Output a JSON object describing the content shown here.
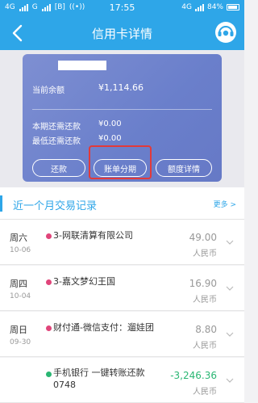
{
  "status_bar": {
    "left_items": [
      "4G",
      "G",
      "[B]",
      "((•))"
    ],
    "time": "17:55",
    "network": "4G",
    "battery": "84%"
  },
  "header": {
    "title": "信用卡详情"
  },
  "card": {
    "balance_label": "当前余额",
    "balance_value": "¥1,114.66",
    "due_label": "本期还需还款",
    "due_value": "¥0.00",
    "min_label": "最低还需还款",
    "min_value": "¥0.00",
    "btn_repay": "还款",
    "btn_installment": "账单分期",
    "btn_limit": "额度详情"
  },
  "section": {
    "title": "近一个月交易记录",
    "more": "更多 >"
  },
  "colors": {
    "brand": "#2ea6e8",
    "card": "#6e82cc",
    "highlight": "#e23a3a",
    "negative_amount": "#2ab673",
    "dot_red": "#e0457a",
    "dot_green": "#2ab673"
  },
  "transactions": [
    {
      "day": "周六",
      "date": "10-06",
      "desc": "3-网联清算有限公司",
      "desc2": "",
      "amount": "49.00",
      "currency": "人民币",
      "dot": "red"
    },
    {
      "day": "周四",
      "date": "10-04",
      "desc": "3-嘉文梦幻王国",
      "desc2": "",
      "amount": "16.90",
      "currency": "人民币",
      "dot": "red"
    },
    {
      "day": "周日",
      "date": "09-30",
      "desc": "财付通-微信支付：遛娃团",
      "desc2": "",
      "amount": "8.80",
      "currency": "人民币",
      "dot": "red"
    },
    {
      "day": "",
      "date": "",
      "desc": "手机银行 一键转账还款",
      "desc2": "0748",
      "amount": "-3,246.36",
      "currency": "人民币",
      "dot": "green"
    }
  ]
}
